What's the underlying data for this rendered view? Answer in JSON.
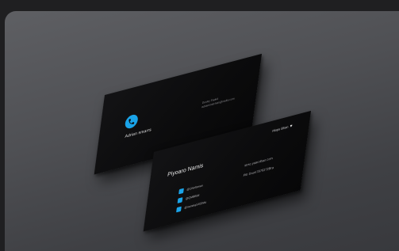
{
  "back_card": {
    "logo_icon": "phone-icon",
    "brand": "Adrian smarrs",
    "contact_line_1": "Duxley Faded",
    "contact_line_2": "adriansmitchels@mellis.com"
  },
  "front_card": {
    "name": "Piyoaro Namis",
    "tagline": "Hisps Bhan",
    "heart_icon": "heart-icon",
    "social": [
      {
        "icon": "twitter-icon",
        "text": "@Chiofaman"
      },
      {
        "icon": "facebook-icon",
        "text": "@QMBB84"
      },
      {
        "icon": "instagram-icon",
        "text": "@namingSSSIMa"
      }
    ],
    "right_line_1": "strsc.yaarolbao.com",
    "right_line_2": "Pitr Drum7876272Bra"
  },
  "colors": {
    "accent": "#1aa3e8",
    "card": "#0d0d0e",
    "background": "#4f5054"
  }
}
